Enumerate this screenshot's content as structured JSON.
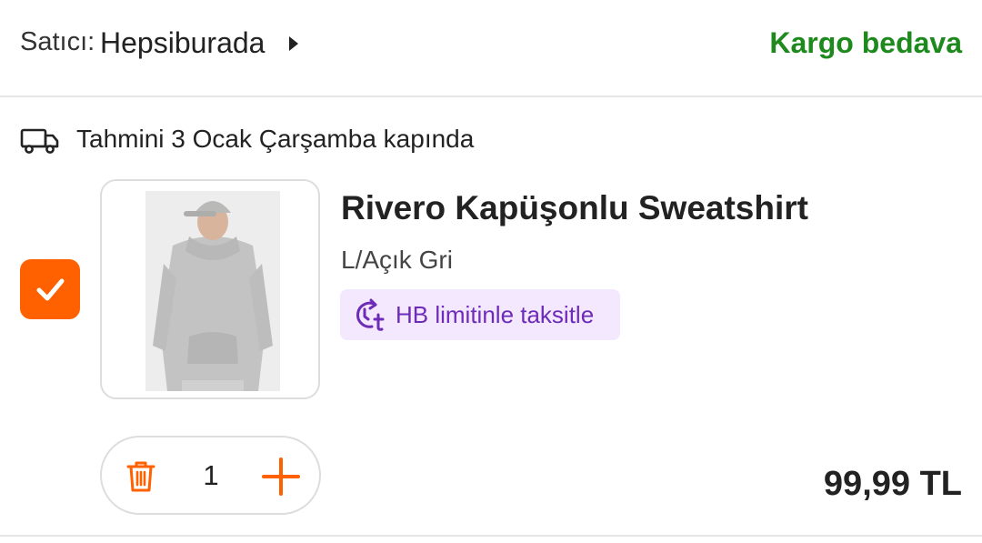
{
  "seller": {
    "prefix": "Satıcı:",
    "name": "Hepsiburada",
    "shipping_label": "Kargo bedava"
  },
  "delivery": {
    "icon": "truck-icon",
    "estimate_text": "Tahmini 3 Ocak Çarşamba kapında"
  },
  "item": {
    "selected": true,
    "name": "Rivero Kapüşonlu Sweatshirt",
    "variant": "L/Açık Gri",
    "installment_label": "HB limitinle taksitle",
    "quantity": "1",
    "price": "99,99 TL"
  },
  "colors": {
    "brand_orange": "#ff6000",
    "shipping_green": "#1e8a1e",
    "installment_purple": "#6e2bb8",
    "installment_bg": "#f3e8fd"
  },
  "icons": {
    "checkbox": "check-icon",
    "installment": "clock-installment-icon",
    "remove": "trash-icon",
    "increase": "plus-icon",
    "seller_link": "caret-right-icon"
  }
}
